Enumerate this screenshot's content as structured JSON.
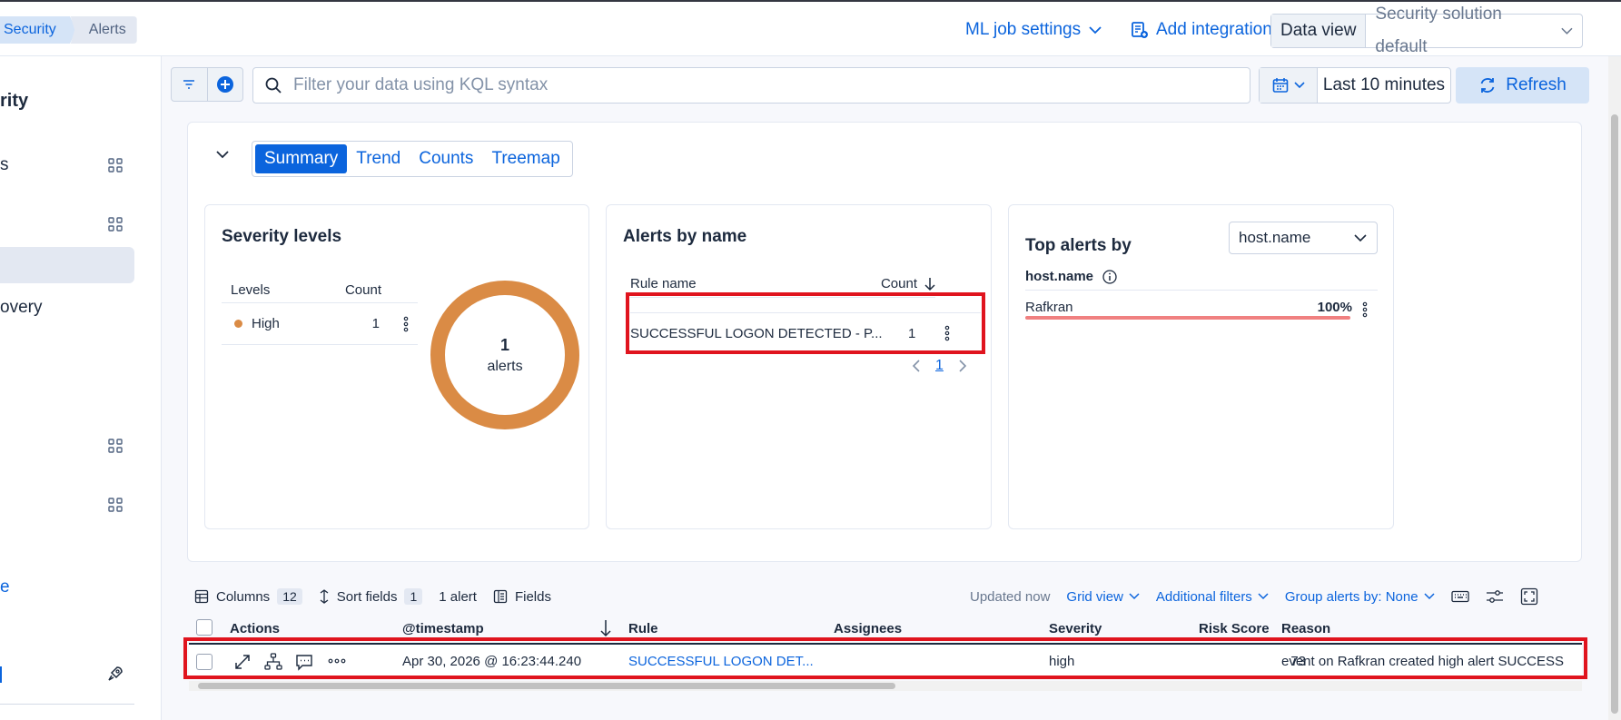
{
  "breadcrumbs": [
    "Security",
    "Alerts"
  ],
  "header": {
    "ml_job_settings": "ML job settings",
    "add_integrations": "Add integrations",
    "data_view_label": "Data view",
    "data_view_value": "Security solution default"
  },
  "sidebar": {
    "title_fragment": "rity",
    "items": [
      "s",
      "",
      "",
      "overy",
      "",
      "",
      "e",
      ""
    ]
  },
  "query": {
    "placeholder": "Filter your data using KQL syntax",
    "date_range": "Last 10 minutes",
    "refresh": "Refresh"
  },
  "tabs": [
    "Summary",
    "Trend",
    "Counts",
    "Treemap"
  ],
  "severity_card": {
    "title": "Severity levels",
    "col_levels": "Levels",
    "col_count": "Count",
    "rows": [
      {
        "level": "High",
        "count": "1"
      }
    ],
    "donut_value": "1",
    "donut_label": "alerts",
    "color_high": "#da8b45"
  },
  "alerts_by_name": {
    "title": "Alerts by name",
    "col_rule": "Rule name",
    "col_count": "Count",
    "rows": [
      {
        "rule": "SUCCESSFUL LOGON DETECTED - P...",
        "count": "1"
      }
    ],
    "page": "1"
  },
  "top_alerts": {
    "title": "Top alerts by",
    "field": "host.name",
    "col_field": "host.name",
    "rows": [
      {
        "name": "Rafkran",
        "percent": "100%",
        "fraction": 1.0
      }
    ]
  },
  "toolbar": {
    "columns_label": "Columns",
    "columns_count": "12",
    "sort_label": "Sort fields",
    "sort_count": "1",
    "alerts_count": "1 alert",
    "fields_label": "Fields",
    "updated": "Updated now",
    "grid_view": "Grid view",
    "additional_filters": "Additional filters",
    "group_by": "Group alerts by: None"
  },
  "grid": {
    "headers": [
      "Actions",
      "@timestamp",
      "Rule",
      "Assignees",
      "Severity",
      "Risk Score",
      "Reason"
    ],
    "row": {
      "timestamp": "Apr 30, 2026 @ 16:23:44.240",
      "rule": "SUCCESSFUL LOGON DET...",
      "assignees": "",
      "severity": "high",
      "risk_score": "73",
      "reason": "event on Rafkran created high alert SUCCESS"
    }
  },
  "colors": {
    "accent": "#0b64dd",
    "highlight_box": "#e0141e",
    "host_bar": "#f08080"
  }
}
